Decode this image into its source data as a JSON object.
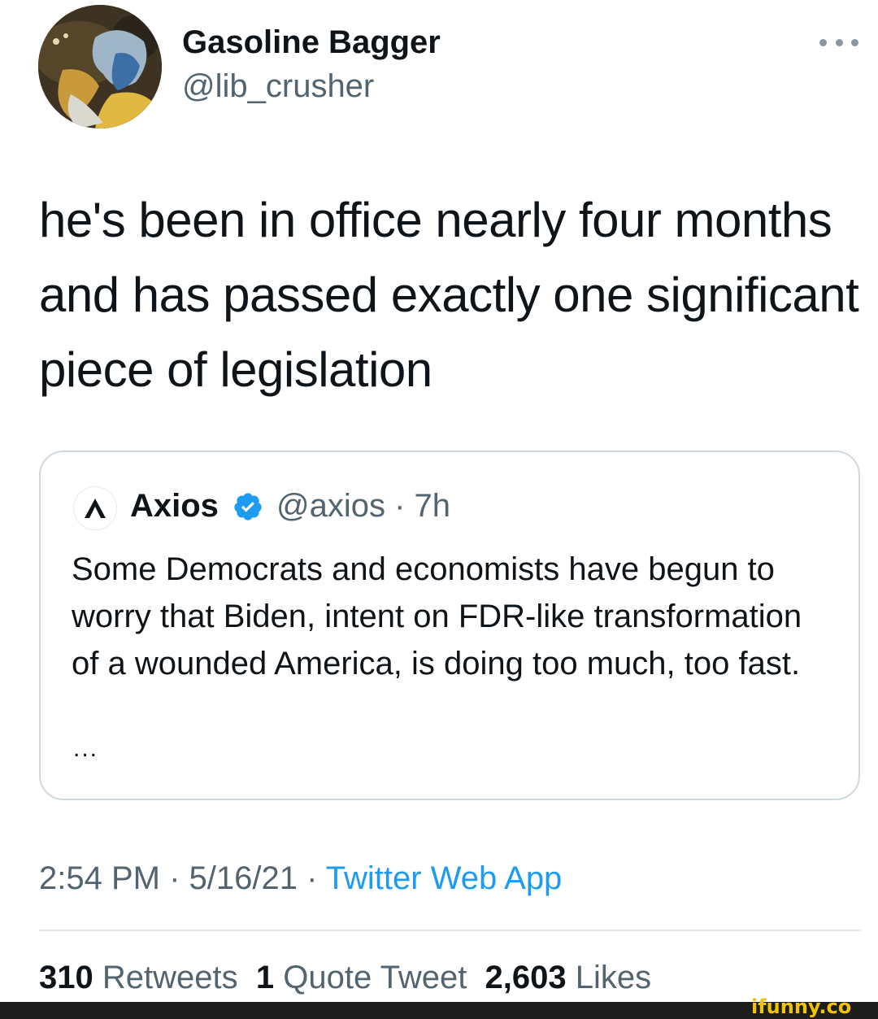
{
  "tweet": {
    "author": {
      "display_name": "Gasoline Bagger",
      "handle": "@lib_crusher"
    },
    "text": "he's been in office nearly four months and has passed exactly one significant piece of legislation",
    "quoted_tweet": {
      "display_name": "Axios",
      "handle_time": "@axios · 7h",
      "text": "Some Democrats and economists have begun to worry that Biden, intent on FDR-like transformation of a wounded America, is doing too much, too fast.",
      "ellipsis": "...",
      "avatar_glyph": "Λ"
    },
    "timestamp": "2:54 PM · 5/16/21 · ",
    "source": "Twitter Web App",
    "stats": {
      "retweets_count": "310",
      "retweets_label": "Retweets",
      "quote_count": "1",
      "quote_label": "Quote Tweet",
      "likes_count": "2,603",
      "likes_label": "Likes"
    }
  },
  "watermark": "ifunny.co",
  "colors": {
    "link_blue": "#1d9bf0",
    "muted_gray": "#536471",
    "verified_blue": "#1d9bf0",
    "watermark_yellow": "#f2c300"
  },
  "icons": {
    "more": "more-options-icon",
    "verified": "verified-badge-icon"
  }
}
